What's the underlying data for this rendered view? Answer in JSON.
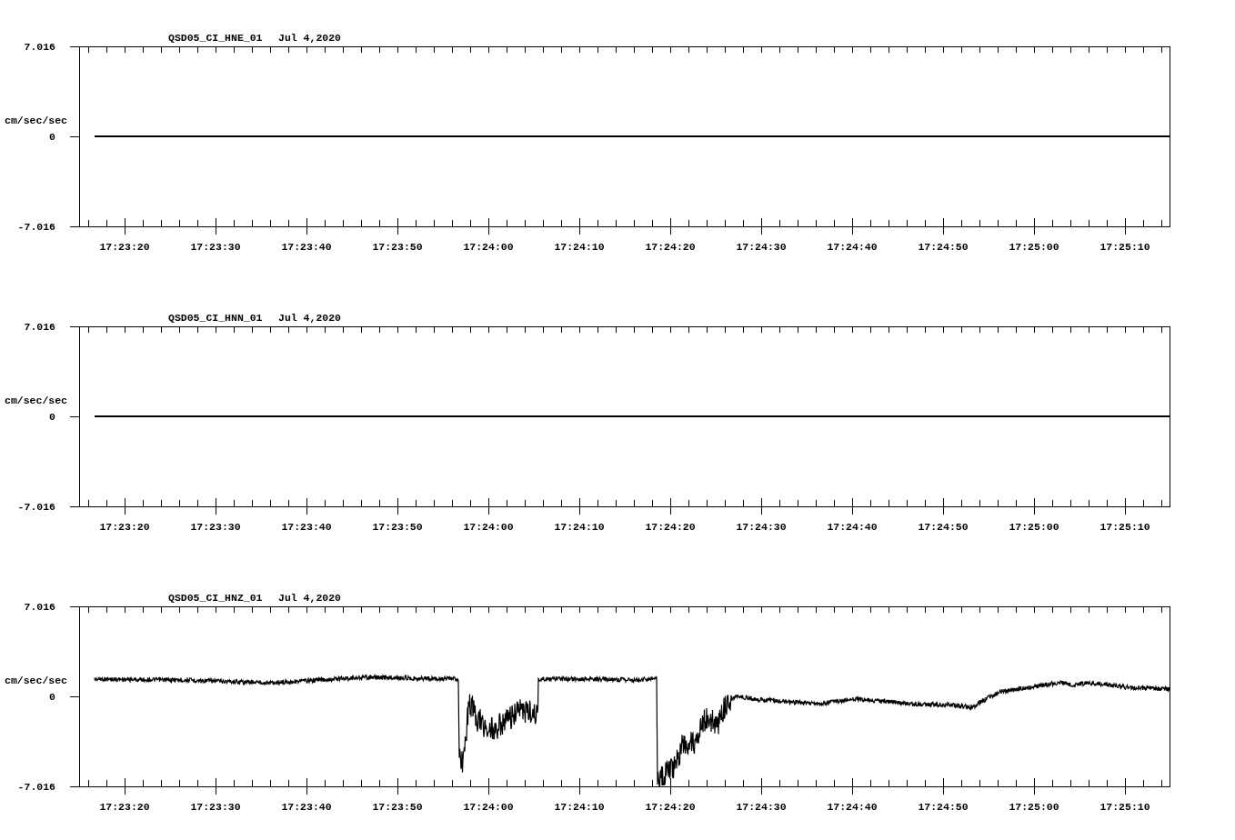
{
  "panels": [
    {
      "title": "QSD05_CI_HNE_01",
      "date": "Jul 4,2020",
      "ylabel": "cm/sec/sec",
      "yticks": [
        "7.016",
        "0",
        "-7.016"
      ],
      "xticks": [
        "17:23:20",
        "17:23:30",
        "17:23:40",
        "17:23:50",
        "17:24:00",
        "17:24:10",
        "17:24:20",
        "17:24:30",
        "17:24:40",
        "17:24:50",
        "17:25:00",
        "17:25:10"
      ],
      "trace": {
        "kind": "flat"
      }
    },
    {
      "title": "QSD05_CI_HNN_01",
      "date": "Jul 4,2020",
      "ylabel": "cm/sec/sec",
      "yticks": [
        "7.016",
        "0",
        "-7.016"
      ],
      "xticks": [
        "17:23:20",
        "17:23:30",
        "17:23:40",
        "17:23:50",
        "17:24:00",
        "17:24:10",
        "17:24:20",
        "17:24:30",
        "17:24:40",
        "17:24:50",
        "17:25:00",
        "17:25:10"
      ],
      "trace": {
        "kind": "flat"
      }
    },
    {
      "title": "QSD05_CI_HNZ_01",
      "date": "Jul 4,2020",
      "ylabel": "cm/sec/sec",
      "yticks": [
        "7.016",
        "0",
        "-7.016"
      ],
      "xticks": [
        "17:23:20",
        "17:23:30",
        "17:23:40",
        "17:23:50",
        "17:24:00",
        "17:24:10",
        "17:24:20",
        "17:24:30",
        "17:24:40",
        "17:24:50",
        "17:25:00",
        "17:25:10"
      ],
      "trace": {
        "kind": "waveform"
      }
    }
  ]
}
